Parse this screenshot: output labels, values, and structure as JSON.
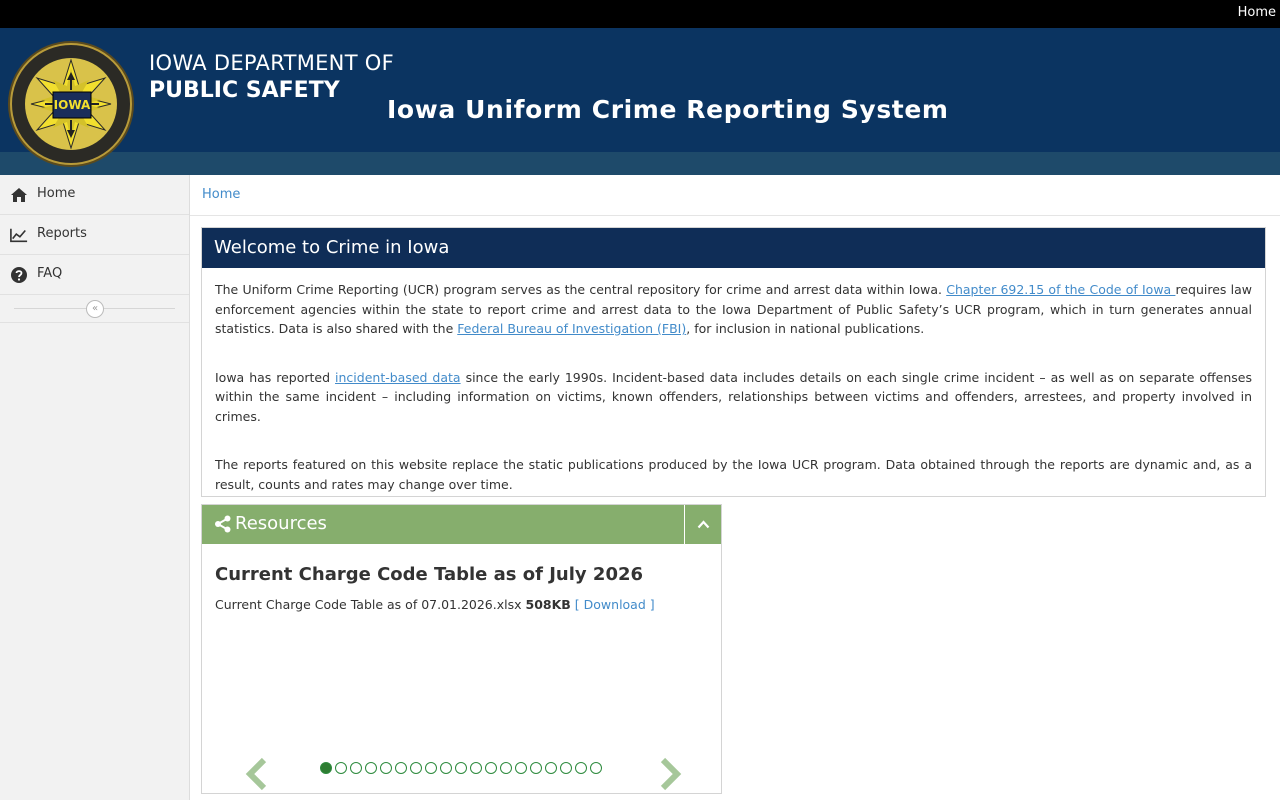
{
  "topbar": {
    "home_link": "Home"
  },
  "header": {
    "dept_line1": "IOWA DEPARTMENT OF",
    "dept_line2": "PUBLIC SAFETY",
    "system_title": "Iowa Uniform Crime Reporting System",
    "seal_text": "IOWA",
    "seal_ring_text": "DEPARTMENT OF PUBLIC SAFETY · PROTECTION ALL WAYS"
  },
  "sidebar": {
    "items": [
      {
        "label": "Home",
        "icon": "home-icon"
      },
      {
        "label": "Reports",
        "icon": "line-chart-icon"
      },
      {
        "label": "FAQ",
        "icon": "question-circle-icon"
      }
    ],
    "collapse_glyph": "«"
  },
  "breadcrumb": {
    "home": "Home"
  },
  "welcome": {
    "title": "Welcome to Crime in Iowa",
    "p1_before": "The Uniform Crime Reporting (UCR) program serves as the central repository for crime and arrest data within Iowa. ",
    "p1_link1": "Chapter 692.15 of the Code of Iowa ",
    "p1_middle": "requires law enforcement agencies within the state to report crime and arrest data to the Iowa Department of Public Safety’s UCR program, which in turn generates annual statistics. Data is also shared with the ",
    "p1_link2": "Federal Bureau of Investigation (FBI)",
    "p1_after": ", for inclusion in national publications.",
    "p2_before": "Iowa has reported ",
    "p2_link": "incident-based data",
    "p2_after": " since the early 1990s. Incident-based data includes details on each single crime incident – as well as on separate offenses within the same incident – including information on victims, known offenders, relationships between victims and offenders, arrestees, and property involved in crimes.",
    "p3": "The reports featured on this website replace the static publications produced by the Iowa UCR program. Data obtained through the reports are dynamic and, as a result, counts and rates may change over time."
  },
  "resources": {
    "title": "Resources",
    "slide_title": "Current Charge Code Table as of July 2026",
    "file_name": "Current Charge Code Table as of 07.01.2026.xlsx",
    "file_size": "508KB",
    "download_label": "[ Download ]",
    "slide_count": 19,
    "active_slide": 1
  },
  "colors": {
    "banner": "#0b3461",
    "welcome_header": "#0f2d57",
    "resources_header": "#86ae6d",
    "link": "#428bca",
    "carousel_dot": "#2e7d32"
  }
}
